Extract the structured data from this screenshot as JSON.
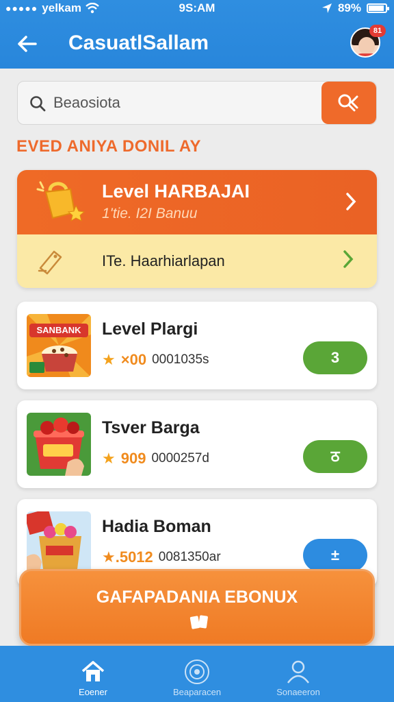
{
  "status_bar": {
    "carrier": "yelkam",
    "time": "9S:AM",
    "battery": "89%"
  },
  "app_bar": {
    "title": "CasuatlSallam",
    "notification_badge": "81"
  },
  "search": {
    "placeholder": "Beaosiota"
  },
  "section_title": "EVED ANIYA DONIL AY",
  "promo": {
    "title": "Level HARBAJAI",
    "subtitle": "1'tie. I2I Banuu",
    "secondary_text": "ITe. Haarhiarlapan"
  },
  "games": [
    {
      "title": "Level Plargi",
      "rating": "×00",
      "count": "0001035s",
      "action": "3",
      "action_color": "#5aa637"
    },
    {
      "title": "Tsver Barga",
      "rating": "909",
      "count": "0000257d",
      "action": "ठ",
      "action_color": "#5aa637"
    },
    {
      "title": "Hadia Boman",
      "rating": "★.5012",
      "count": "0081350ar",
      "action": "±",
      "action_color": "#2d8ce0"
    }
  ],
  "thumb_text": [
    "SANBANK",
    "",
    ""
  ],
  "cta": {
    "label": "GAFAPADANIA EBONUX"
  },
  "bottom_nav": [
    {
      "label": "Eoener",
      "icon": "home-icon"
    },
    {
      "label": "Beaparacen",
      "icon": "gamepad-icon"
    },
    {
      "label": "Sonaeeron",
      "icon": "profile-icon"
    }
  ],
  "colors": {
    "primary_blue": "#2f8ee0",
    "accent_orange": "#ef6a2a",
    "promo_yellow": "#fbe9a6",
    "green": "#5aa637"
  }
}
